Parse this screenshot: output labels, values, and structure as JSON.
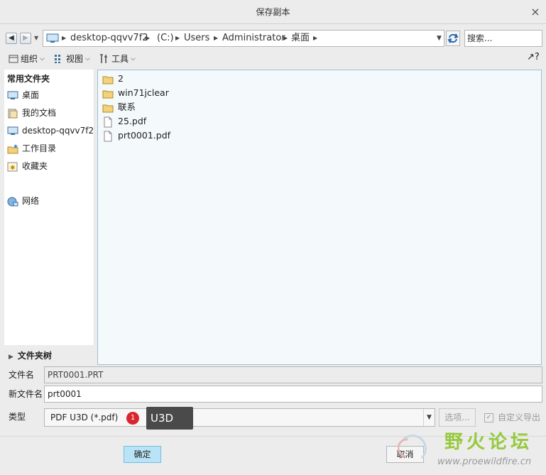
{
  "window": {
    "title": "保存副本",
    "close_glyph": "×"
  },
  "nav": {
    "breadcrumbs": [
      "desktop-qqvv7f2",
      "(C:)",
      "Users",
      "Administrator",
      "桌面"
    ],
    "search_placeholder": "搜索..."
  },
  "toolbar": {
    "organize": "组织",
    "view": "视图",
    "tools": "工具"
  },
  "sidebar": {
    "header": "常用文件夹",
    "items": [
      {
        "label": "桌面",
        "icon": "desktop-icon"
      },
      {
        "label": "我的文档",
        "icon": "documents-icon"
      },
      {
        "label": "desktop-qqvv7f2",
        "icon": "computer-icon"
      },
      {
        "label": "工作目录",
        "icon": "working-directory-icon"
      },
      {
        "label": "收藏夹",
        "icon": "favorites-icon"
      },
      {
        "label": "网络",
        "icon": "network-icon"
      }
    ]
  },
  "files": [
    {
      "name": "2",
      "type": "folder"
    },
    {
      "name": "win71jclear",
      "type": "folder"
    },
    {
      "name": "联系",
      "type": "folder"
    },
    {
      "name": "25.pdf",
      "type": "file"
    },
    {
      "name": "prt0001.pdf",
      "type": "file"
    }
  ],
  "folder_tree": {
    "label": "文件夹树"
  },
  "form": {
    "filename_label": "文件名",
    "filename_value": "PRT0001.PRT",
    "new_filename_label": "新文件名",
    "new_filename_value": "prt0001",
    "type_label": "类型",
    "type_value": "PDF U3D (*.pdf)",
    "options_label": "选项...",
    "custom_export_label": "自定义导出"
  },
  "annotation": {
    "number": "1",
    "text": "U3D"
  },
  "buttons": {
    "ok": "确定",
    "cancel": "取消"
  },
  "watermark": {
    "text": "野火论坛",
    "url": "www.proewildfire.cn"
  },
  "colors": {
    "accent": "#b9e3f6",
    "list_bg": "#f4f9fc",
    "watermark_green": "#96c93d",
    "badge_red": "#d9262e"
  }
}
